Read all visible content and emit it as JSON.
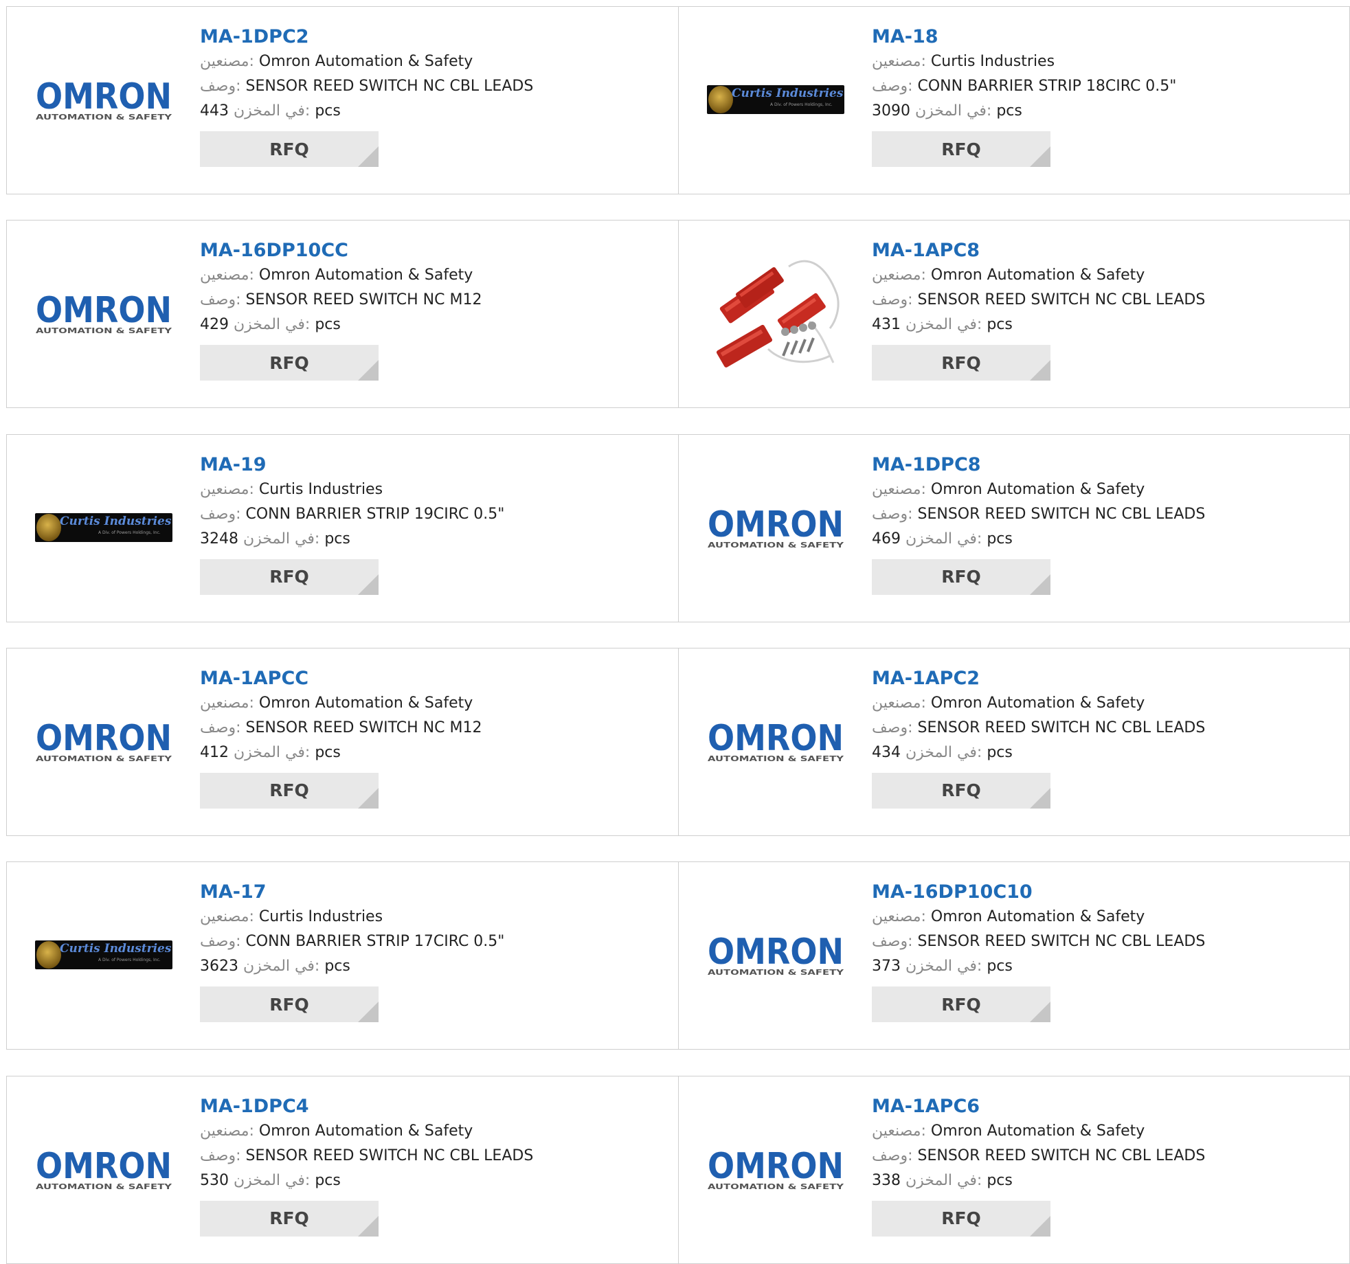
{
  "labels": {
    "manufacturer": "مصنعين:",
    "description": "وصف:",
    "stock": "في المخزن:",
    "unit": "pcs",
    "rfq": "RFQ"
  },
  "brands": {
    "omron": {
      "name": "OMRON",
      "tagline": "AUTOMATION & SAFETY",
      "color": "#1f5fb0"
    },
    "curtis": {
      "name": "Curtis Industries",
      "tagline": "A Div. of Powers Holdings, Inc."
    }
  },
  "products": [
    {
      "part": "MA-1DPC2",
      "manufacturer": "Omron Automation & Safety",
      "description": "SENSOR REED SWITCH NC CBL LEADS",
      "stock": "443",
      "logo": "omron"
    },
    {
      "part": "MA-18",
      "manufacturer": "Curtis Industries",
      "description": "CONN BARRIER STRIP 18CIRC 0.5\"",
      "stock": "3090",
      "logo": "curtis"
    },
    {
      "part": "MA-16DP10CC",
      "manufacturer": "Omron Automation & Safety",
      "description": "SENSOR REED SWITCH NC M12",
      "stock": "429",
      "logo": "omron"
    },
    {
      "part": "MA-1APC8",
      "manufacturer": "Omron Automation & Safety",
      "description": "SENSOR REED SWITCH NC CBL LEADS",
      "stock": "431",
      "logo": "photo"
    },
    {
      "part": "MA-19",
      "manufacturer": "Curtis Industries",
      "description": "CONN BARRIER STRIP 19CIRC 0.5\"",
      "stock": "3248",
      "logo": "curtis"
    },
    {
      "part": "MA-1DPC8",
      "manufacturer": "Omron Automation & Safety",
      "description": "SENSOR REED SWITCH NC CBL LEADS",
      "stock": "469",
      "logo": "omron"
    },
    {
      "part": "MA-1APCC",
      "manufacturer": "Omron Automation & Safety",
      "description": "SENSOR REED SWITCH NC M12",
      "stock": "412",
      "logo": "omron"
    },
    {
      "part": "MA-1APC2",
      "manufacturer": "Omron Automation & Safety",
      "description": "SENSOR REED SWITCH NC CBL LEADS",
      "stock": "434",
      "logo": "omron"
    },
    {
      "part": "MA-17",
      "manufacturer": "Curtis Industries",
      "description": "CONN BARRIER STRIP 17CIRC 0.5\"",
      "stock": "3623",
      "logo": "curtis"
    },
    {
      "part": "MA-16DP10C10",
      "manufacturer": "Omron Automation & Safety",
      "description": "SENSOR REED SWITCH NC CBL LEADS",
      "stock": "373",
      "logo": "omron"
    },
    {
      "part": "MA-1DPC4",
      "manufacturer": "Omron Automation & Safety",
      "description": "SENSOR REED SWITCH NC CBL LEADS",
      "stock": "530",
      "logo": "omron"
    },
    {
      "part": "MA-1APC6",
      "manufacturer": "Omron Automation & Safety",
      "description": "SENSOR REED SWITCH NC CBL LEADS",
      "stock": "338",
      "logo": "omron"
    }
  ]
}
